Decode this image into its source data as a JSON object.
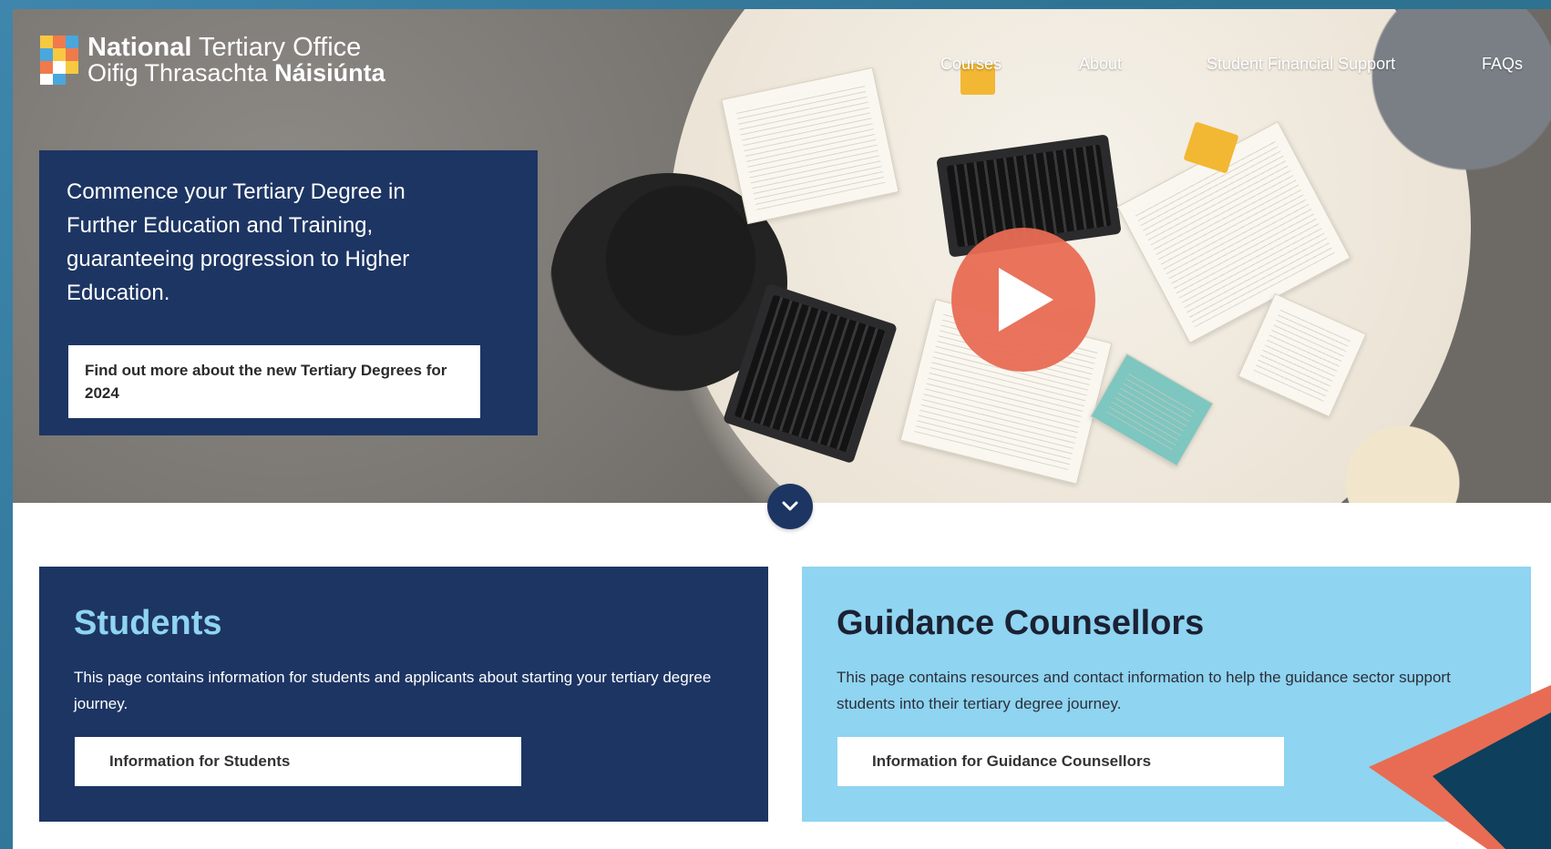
{
  "logo": {
    "line1_bold": "National",
    "line1_rest": " Tertiary Office",
    "line2_rest": "Oifig Thrasachta ",
    "line2_bold": "Náisiúnta"
  },
  "nav": {
    "items": [
      {
        "label": "Courses"
      },
      {
        "label": "About"
      },
      {
        "label": "Student Financial Support"
      },
      {
        "label": "FAQs"
      }
    ]
  },
  "hero": {
    "heading": "Commence your Tertiary Degree in Further Education and Training, guaranteeing progression to Higher Education.",
    "button_label": "Find out more about the new Tertiary Degrees for 2024"
  },
  "panels": {
    "students": {
      "title": "Students",
      "text": "This page contains information for students and applicants about starting your tertiary degree journey.",
      "button_label": "Information for Students"
    },
    "guidance": {
      "title": "Guidance Counsellors",
      "text": "This page contains resources and contact information to help the guidance sector support students into their tertiary degree journey.",
      "button_label": "Information for Guidance Counsellors"
    }
  },
  "colors": {
    "navy": "#1d3563",
    "light_blue": "#8fd4f0",
    "coral": "#e86c53",
    "teal_dark": "#0e3f5c"
  },
  "icons": [
    "play-icon",
    "chevron-down-icon"
  ]
}
